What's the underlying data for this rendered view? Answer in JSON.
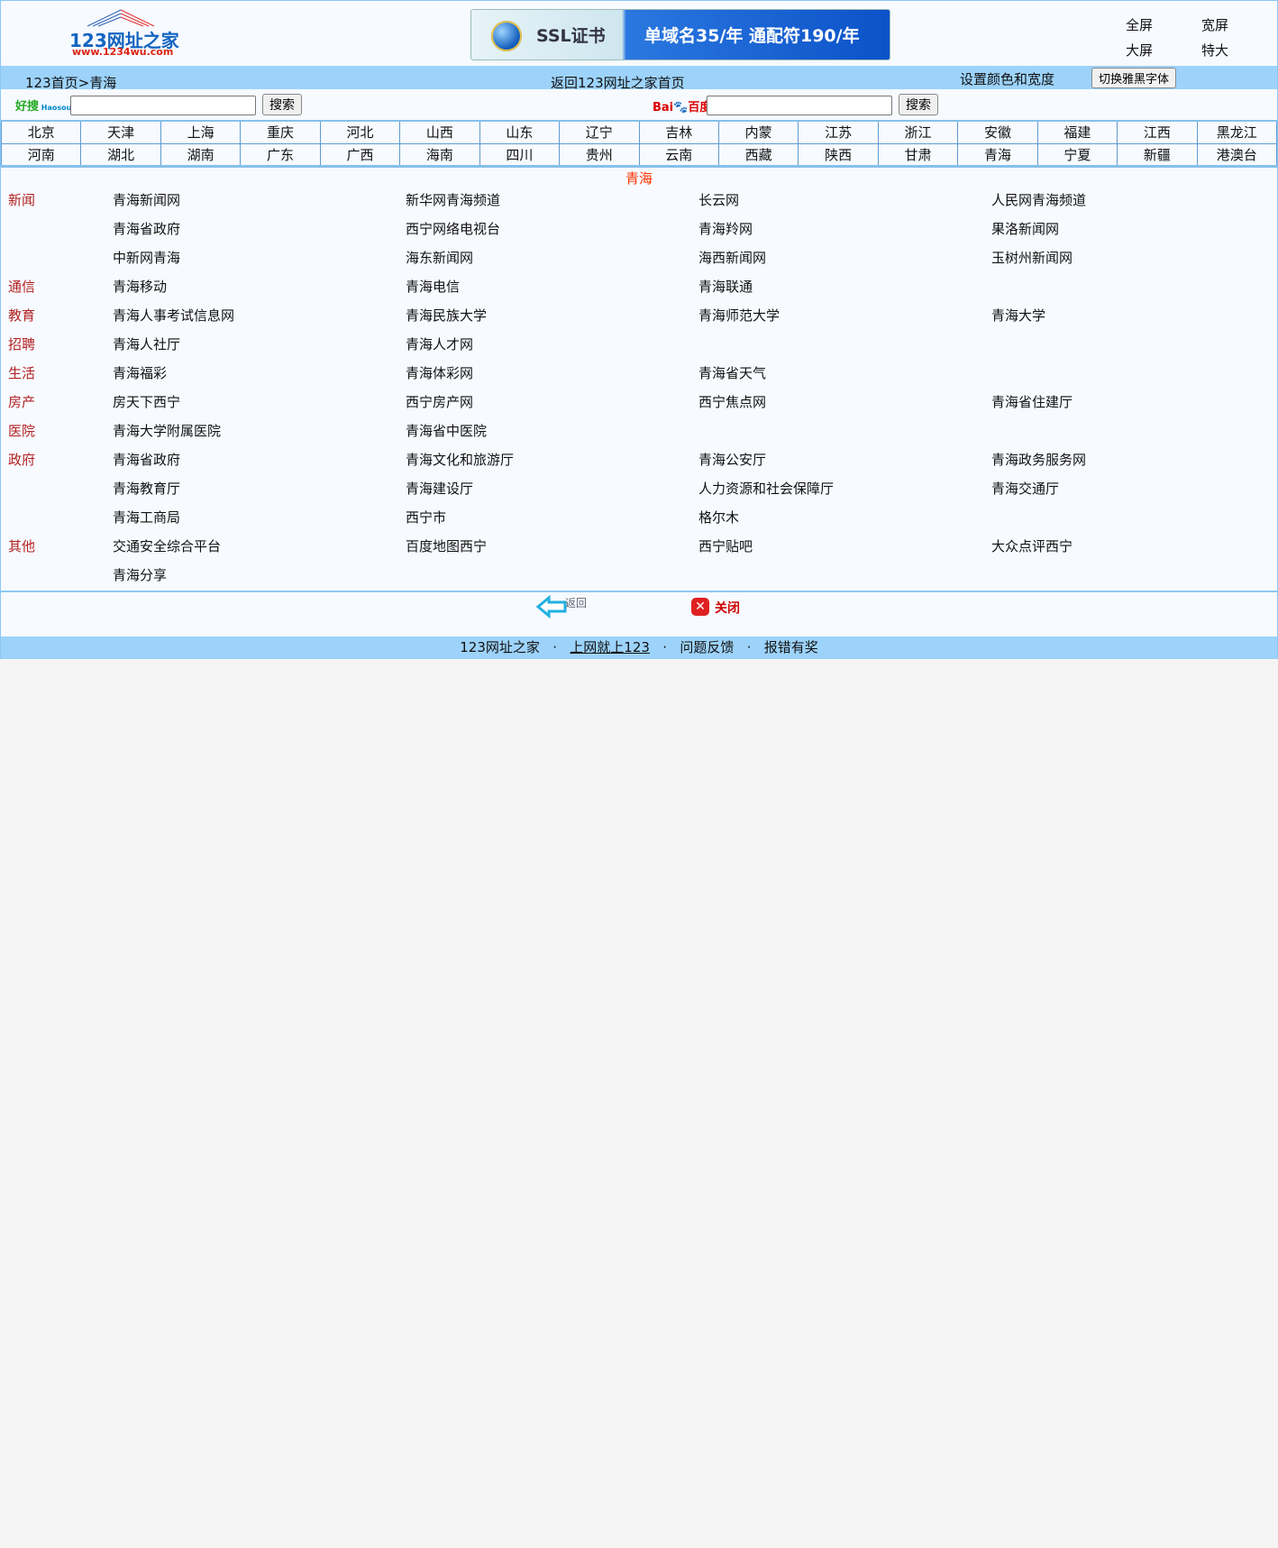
{
  "header": {
    "logo_text": "123网址之家",
    "logo_url_text": "www.1234wu.com",
    "banner": {
      "title": "SSL证书",
      "offer": "单域名35/年  通配符190/年"
    },
    "size_options": [
      "全屏",
      "宽屏",
      "大屏",
      "特大"
    ]
  },
  "nav": {
    "breadcrumb": "123首页>青海",
    "home_link": "返回123网址之家首页",
    "settings": "设置颜色和宽度",
    "switch_font": "切换雅黑字体"
  },
  "search": [
    {
      "engine": "好搜",
      "placeholder": "",
      "value": "",
      "button": "搜索"
    },
    {
      "engine": "百度",
      "placeholder": "",
      "value": "",
      "button": "搜索"
    }
  ],
  "provinces": [
    [
      "北京",
      "天津",
      "上海",
      "重庆",
      "河北",
      "山西",
      "山东",
      "辽宁",
      "吉林",
      "内蒙",
      "江苏",
      "浙江",
      "安徽",
      "福建",
      "江西",
      "黑龙江"
    ],
    [
      "河南",
      "湖北",
      "湖南",
      "广东",
      "广西",
      "海南",
      "四川",
      "贵州",
      "云南",
      "西藏",
      "陕西",
      "甘肃",
      "青海",
      "宁夏",
      "新疆",
      "港澳台"
    ]
  ],
  "section_title": "青海",
  "rows": [
    {
      "cat": "新闻",
      "links": [
        "青海新闻网",
        "新华网青海频道",
        "长云网",
        "人民网青海频道"
      ]
    },
    {
      "cat": "",
      "links": [
        "青海省政府",
        "西宁网络电视台",
        "青海羚网",
        "果洛新闻网"
      ]
    },
    {
      "cat": "",
      "links": [
        "中新网青海",
        "海东新闻网",
        "海西新闻网",
        "玉树州新闻网"
      ]
    },
    {
      "cat": "通信",
      "links": [
        "青海移动",
        "青海电信",
        "青海联通",
        ""
      ]
    },
    {
      "cat": "教育",
      "links": [
        "青海人事考试信息网",
        "青海民族大学",
        "青海师范大学",
        "青海大学"
      ]
    },
    {
      "cat": "招聘",
      "links": [
        "青海人社厅",
        "青海人才网",
        "",
        ""
      ]
    },
    {
      "cat": "生活",
      "links": [
        "青海福彩",
        "青海体彩网",
        "青海省天气",
        ""
      ]
    },
    {
      "cat": "房产",
      "links": [
        "房天下西宁",
        "西宁房产网",
        "西宁焦点网",
        "青海省住建厅"
      ]
    },
    {
      "cat": "医院",
      "links": [
        "青海大学附属医院",
        "青海省中医院",
        "",
        ""
      ]
    },
    {
      "cat": "政府",
      "links": [
        "青海省政府",
        "青海文化和旅游厅",
        "青海公安厅",
        "青海政务服务网"
      ]
    },
    {
      "cat": "",
      "links": [
        "青海教育厅",
        "青海建设厅",
        "人力资源和社会保障厅",
        "青海交通厅"
      ]
    },
    {
      "cat": "",
      "links": [
        "青海工商局",
        "西宁市",
        "格尔木",
        ""
      ]
    },
    {
      "cat": "其他",
      "links": [
        "交通安全综合平台",
        "百度地图西宁",
        "西宁贴吧",
        "大众点评西宁"
      ]
    },
    {
      "cat": "",
      "links": [
        "青海分享",
        "",
        "",
        ""
      ]
    }
  ],
  "actions": {
    "back": "返回",
    "close": "关闭"
  },
  "footer": [
    "123网址之家",
    "上网就上123",
    "问题反馈",
    "报错有奖"
  ],
  "colors": {
    "bar": "#9dd3fb",
    "category": "#b22222",
    "section_title": "#ff3300",
    "page_bg": "#f7faff"
  }
}
